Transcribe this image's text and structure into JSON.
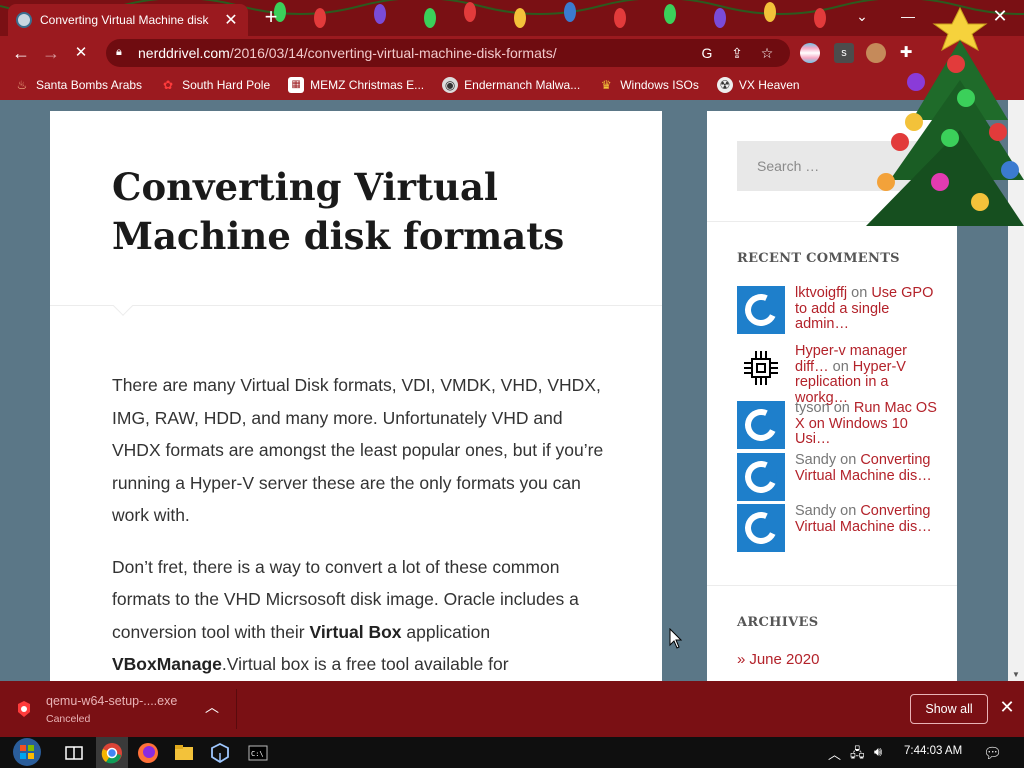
{
  "browser": {
    "tab_title": "Converting Virtual Machine disk",
    "url_host": "nerddrivel.com",
    "url_path": "/2016/03/14/converting-virtual-machine-disk-formats/",
    "bookmarks": [
      {
        "label": "Santa Bombs Arabs",
        "icon": "fire-icon"
      },
      {
        "label": "South Hard Pole",
        "icon": "flower-icon"
      },
      {
        "label": "MEMZ Christmas E...",
        "icon": "memz-icon"
      },
      {
        "label": "Endermanch Malwa...",
        "icon": "raccoon-icon"
      },
      {
        "label": "Windows ISOs",
        "icon": "windows-icon"
      },
      {
        "label": "VX Heaven",
        "icon": "vx-icon"
      }
    ]
  },
  "article": {
    "title": "Converting Virtual Machine disk formats",
    "paragraph1": "There are many Virtual Disk formats, VDI, VMDK, VHD, VHDX, IMG, RAW, HDD, and many more. Unfortunately VHD and VHDX formats are amongst the least popular ones, but if you’re running a Hyper-V server these are the only formats you can work with.",
    "p2_part1": "Don’t fret, there is a way to convert a lot of these common formats to the VHD Micrsosoft disk image. Oracle includes a conversion tool with their ",
    "p2_bold1": "Virtual Box",
    "p2_part2": " application ",
    "p2_bold2": "VBoxManage",
    "p2_part3": ".Virtual box is a free tool available for"
  },
  "sidebar": {
    "search_placeholder": "Search …",
    "recent_comments_title": "RECENT COMMENTS",
    "comments": [
      {
        "author": "lktvoigffj",
        "on": "on",
        "post": "Use GPO to add a single admin…",
        "author_linked": true
      },
      {
        "author": "Hyper-v manager diff…",
        "on": "on",
        "post": "Hyper-V replication in a workg…",
        "author_linked": true
      },
      {
        "author": "tyson",
        "on": "on",
        "post": "Run Mac OS X on Windows 10 Usi…",
        "author_linked": false
      },
      {
        "author": "Sandy",
        "on": "on",
        "post": "Converting Virtual Machine dis…",
        "author_linked": false
      },
      {
        "author": "Sandy",
        "on": "on",
        "post": "Converting Virtual Machine dis…",
        "author_linked": false
      }
    ],
    "archives_title": "ARCHIVES",
    "archive_item": "June 2020"
  },
  "download": {
    "filename": "qemu-w64-setup-....exe",
    "status": "Canceled",
    "show_all": "Show all"
  },
  "taskbar": {
    "clock": "7:44:03 AM"
  },
  "colors": {
    "accent_red": "#9b1a1f",
    "link_red": "#b3222a",
    "page_bg": "#5b7787"
  }
}
